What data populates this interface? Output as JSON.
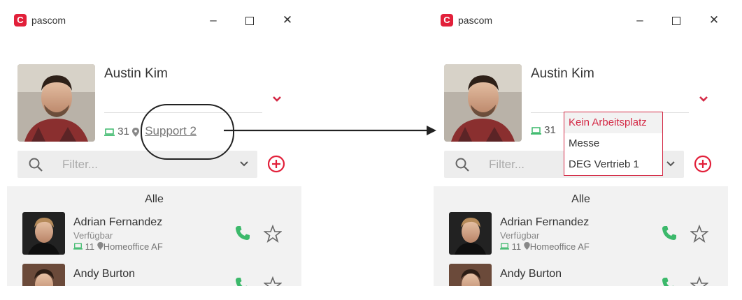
{
  "app": {
    "name": "pascom",
    "logo_letter": "C"
  },
  "window_controls": {
    "minimize": "–",
    "maximize": "",
    "close": "✕"
  },
  "left": {
    "user": {
      "name": "Austin Kim",
      "extension": "31",
      "location": "Support 2"
    },
    "filter": {
      "placeholder": "Filter..."
    },
    "list": {
      "group_title": "Alle",
      "contacts": [
        {
          "name": "Adrian Fernandez",
          "status": "Verfügbar",
          "extension": "11",
          "location": "Homeoffice AF"
        },
        {
          "name": "Andy Burton"
        }
      ]
    }
  },
  "right": {
    "user": {
      "name": "Austin Kim",
      "extension": "31"
    },
    "filter": {
      "placeholder": "Filter..."
    },
    "dropdown": {
      "options": [
        "Kein Arbeitsplatz",
        "Messe",
        "DEG Vertrieb 1"
      ]
    },
    "list": {
      "group_title": "Alle",
      "contacts": [
        {
          "name": "Adrian Fernandez",
          "status": "Verfügbar",
          "extension": "11",
          "location": "Homeoffice AF"
        },
        {
          "name": "Andy Burton"
        }
      ]
    }
  },
  "colors": {
    "brand": "#e2203a",
    "accent_red": "#d42a46",
    "green": "#3cb96b",
    "list_bg": "#f2f2f2"
  },
  "icons": [
    "pascom-logo-icon",
    "minimize-icon",
    "maximize-icon",
    "close-icon",
    "chevron-down-icon",
    "laptop-icon",
    "location-pin-icon",
    "search-icon",
    "add-circle-icon",
    "phone-icon",
    "star-icon"
  ]
}
